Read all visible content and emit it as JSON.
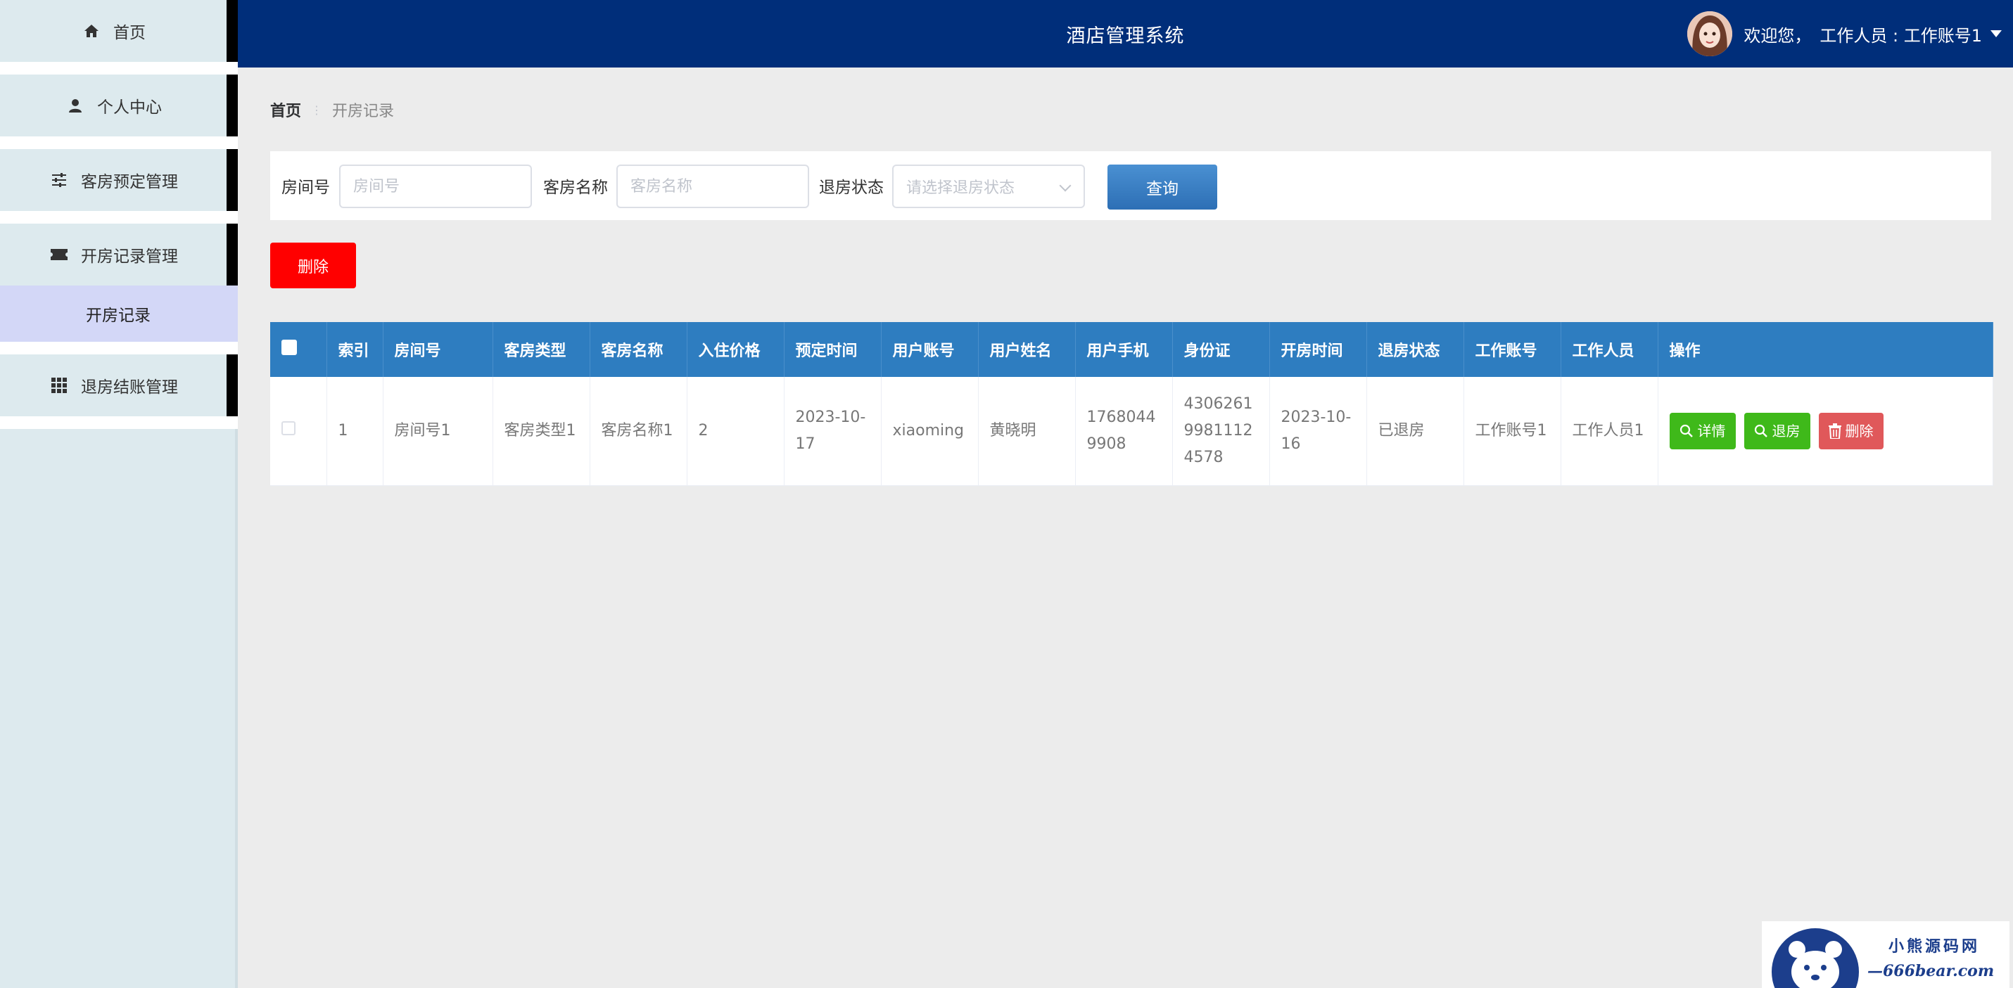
{
  "header": {
    "title": "酒店管理系统",
    "welcome": "欢迎您，",
    "user": "工作人员 : 工作账号1"
  },
  "sidebar": {
    "items": [
      {
        "label": "首页",
        "icon": "home-icon"
      },
      {
        "label": "个人中心",
        "icon": "user-icon"
      },
      {
        "label": "客房预定管理",
        "icon": "sliders-icon"
      },
      {
        "label": "开房记录管理",
        "icon": "ticket-icon"
      },
      {
        "label": "退房结账管理",
        "icon": "grid-icon"
      }
    ],
    "submenu": {
      "label": "开房记录"
    }
  },
  "breadcrumb": {
    "home": "首页",
    "separator": "⋮",
    "current": "开房记录"
  },
  "search": {
    "room_label": "房间号",
    "room_placeholder": "房间号",
    "guest_label": "客房名称",
    "guest_placeholder": "客房名称",
    "status_label": "退房状态",
    "status_placeholder": "请选择退房状态",
    "query_label": "查询"
  },
  "actions": {
    "delete_label": "删除"
  },
  "table": {
    "headers": [
      "索引",
      "房间号",
      "客房类型",
      "客房名称",
      "入住价格",
      "预定时间",
      "用户账号",
      "用户姓名",
      "用户手机",
      "身份证",
      "开房时间",
      "退房状态",
      "工作账号",
      "工作人员",
      "操作"
    ],
    "rows": [
      {
        "index": "1",
        "room": "房间号1",
        "type": "客房类型1",
        "name": "客房名称1",
        "price": "2",
        "booked": "2023-10-17",
        "account": "xiaoming",
        "username": "黄晓明",
        "phone": "17680449908",
        "idcard": "430626199811124578",
        "opened": "2023-10-16",
        "status": "已退房",
        "staff_account": "工作账号1",
        "staff": "工作人员1",
        "ops": {
          "detail": "详情",
          "checkout": "退房",
          "delete": "删除"
        }
      }
    ]
  },
  "watermark": {
    "line1": "小熊源码网",
    "line2": "—666bear.com—"
  },
  "colors": {
    "header": "#002e7a",
    "table_header": "#2e7dc0",
    "delete": "#ff0000",
    "ok": "#3fb91a",
    "danger": "#e0585a"
  }
}
